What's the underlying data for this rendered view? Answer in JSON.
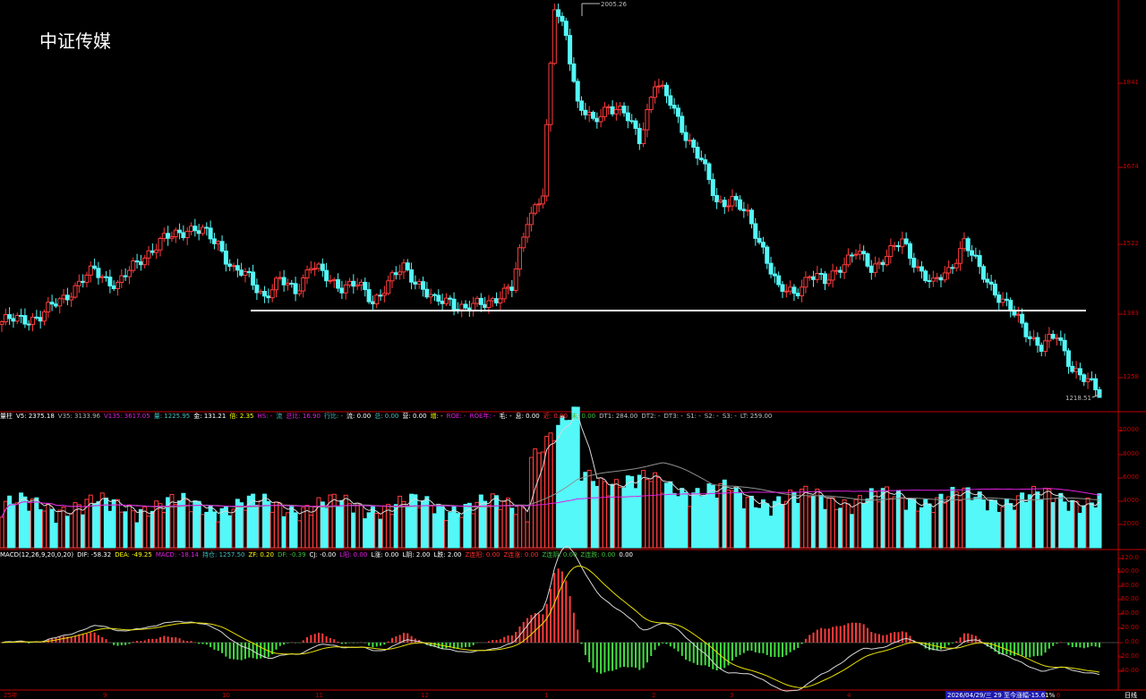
{
  "title": "中证传媒",
  "price_panel": {
    "high_label": "2005.26",
    "low_label": "1218.51",
    "y_ticks": [
      "1841",
      "1674",
      "1522",
      "1383",
      "1258"
    ]
  },
  "volume_panel": {
    "y_ticks": [
      "10000",
      "8000",
      "6000",
      "4000",
      "2000"
    ],
    "info": [
      {
        "text": "量柱",
        "color": "#ffffff"
      },
      {
        "text": "V5: 2375.18",
        "color": "#ffffff"
      },
      {
        "text": "V35: 3133.96",
        "color": "#b0b0b0"
      },
      {
        "text": "V135: 3617.05",
        "color": "#e020e0"
      },
      {
        "text": "量: 1225.95",
        "color": "#40c0c0"
      },
      {
        "text": "金: 131.21",
        "color": "#ffffff"
      },
      {
        "text": "倍: 2.35",
        "color": "#ffff00"
      },
      {
        "text": "HS: -",
        "color": "#e020e0"
      },
      {
        "text": "流",
        "color": "#40c0c0"
      },
      {
        "text": "总比: 16.90",
        "color": "#e020e0"
      },
      {
        "text": "行比: -",
        "color": "#40c0c0"
      },
      {
        "text": "流: 0.00",
        "color": "#ffffff"
      },
      {
        "text": "总: 0.00",
        "color": "#40c0c0"
      },
      {
        "text": "营: 0.00",
        "color": "#ffffff"
      },
      {
        "text": "增: -",
        "color": "#ffff00"
      },
      {
        "text": "ROE: -",
        "color": "#e020e0"
      },
      {
        "text": "ROE年: -",
        "color": "#e020e0"
      },
      {
        "text": "毛: -",
        "color": "#ffffff"
      },
      {
        "text": "息: 0.00",
        "color": "#ffffff"
      },
      {
        "text": "近: 0.00",
        "color": "#ff3030"
      },
      {
        "text": "未: 0.00",
        "color": "#40c040"
      },
      {
        "text": "DT1: 284.00",
        "color": "#c0c0c0"
      },
      {
        "text": "DT2: -",
        "color": "#c0c0c0"
      },
      {
        "text": "DT3: -",
        "color": "#c0c0c0"
      },
      {
        "text": "S1: -",
        "color": "#c0c0c0"
      },
      {
        "text": "S2: -",
        "color": "#c0c0c0"
      },
      {
        "text": "S3: -",
        "color": "#c0c0c0"
      },
      {
        "text": "LT: 259.00",
        "color": "#c0c0c0"
      }
    ]
  },
  "macd_panel": {
    "y_ticks": [
      "120.0",
      "100.00",
      "80.00",
      "60.00",
      "40.00",
      "20.00",
      "0.00",
      "-20.00",
      "-40.00"
    ],
    "info": [
      {
        "text": "MACD(12,26,9,20,0,20)",
        "color": "#ffffff"
      },
      {
        "text": "DIF: -58.32",
        "color": "#ffffff"
      },
      {
        "text": "DEA: -49.25",
        "color": "#ffff00"
      },
      {
        "text": "MACD: -18.14",
        "color": "#e020e0"
      },
      {
        "text": "持仓: 1257.50",
        "color": "#40c0c0"
      },
      {
        "text": "ZF: 0.20",
        "color": "#ffff00"
      },
      {
        "text": "DF: -0.39",
        "color": "#40c040"
      },
      {
        "text": "CJ: -0.00",
        "color": "#ffffff"
      },
      {
        "text": "L阳: 0.00",
        "color": "#e020e0"
      },
      {
        "text": "L涨: 0.00",
        "color": "#ffffff"
      },
      {
        "text": "L阴: 2.00",
        "color": "#ffffff"
      },
      {
        "text": "L跌: 2.00",
        "color": "#ffffff"
      },
      {
        "text": "Z连阳: 0.00",
        "color": "#ff3030"
      },
      {
        "text": "Z连涨: 0.00",
        "color": "#ff3030"
      },
      {
        "text": "Z连阴: 0.00",
        "color": "#40c040"
      },
      {
        "text": "Z连跌: 0.00",
        "color": "#40c040"
      },
      {
        "text": "0.00",
        "color": "#ffffff"
      }
    ]
  },
  "footer": {
    "months": [
      "25年",
      "9",
      "10",
      "11",
      "12",
      "1",
      "2",
      "3",
      "4",
      "5",
      "6"
    ],
    "status": "2026/04/29/三 29 至今涨幅-15.61%",
    "period": "日线"
  },
  "colors": {
    "up": "#ff3c3c",
    "down": "#54f8f8",
    "axis": "#c00000",
    "ma_white": "#d8d8d8",
    "ma_yellow": "#e8e000",
    "ma_magenta": "#e020e0"
  }
}
